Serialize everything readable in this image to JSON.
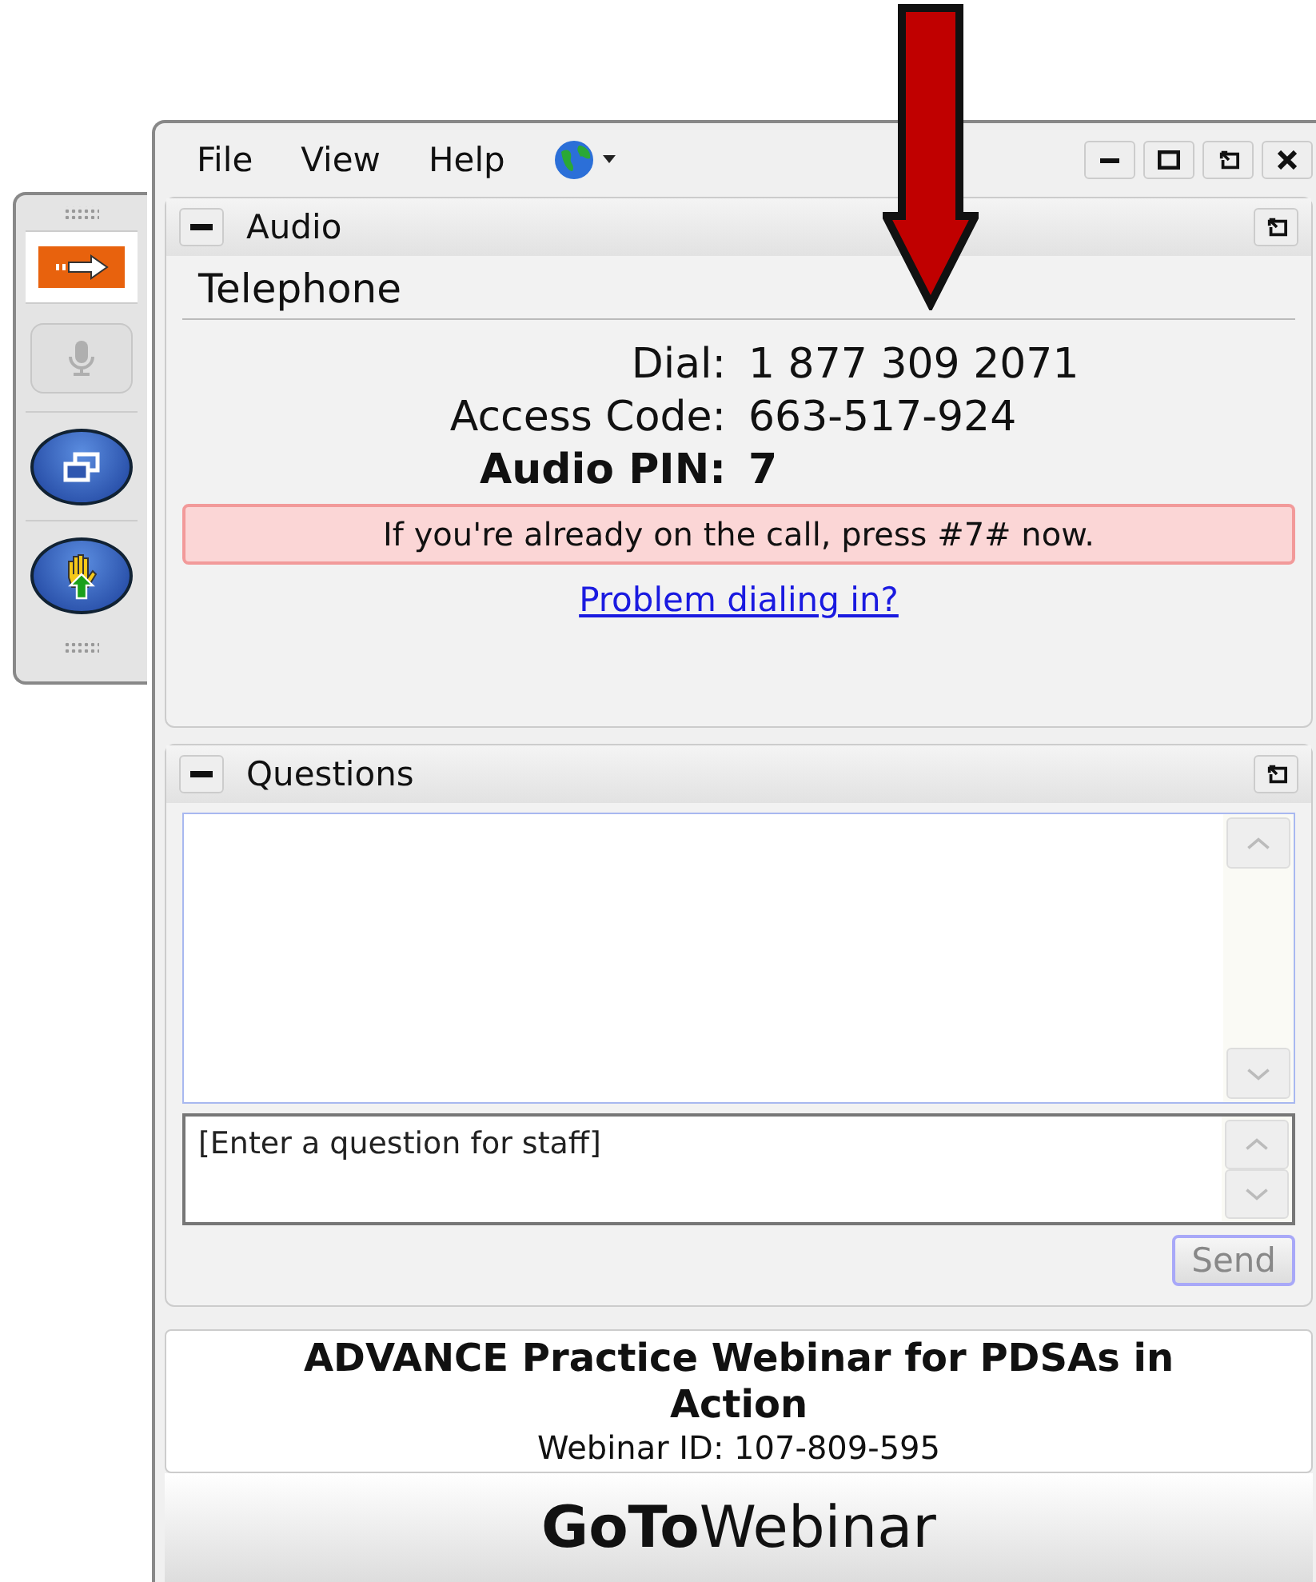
{
  "toolbar": [
    {
      "kind": "arrow",
      "disabled": false
    },
    {
      "kind": "mic",
      "disabled": true
    },
    {
      "kind": "windows",
      "disabled": false
    },
    {
      "kind": "hand",
      "disabled": false
    }
  ],
  "menu": [
    "File",
    "View",
    "Help"
  ],
  "audio": {
    "title": "Audio",
    "heading": "Telephone",
    "rows": [
      {
        "label": "Dial:",
        "value": "1 877 309 2071",
        "bold": false
      },
      {
        "label": "Access Code:",
        "value": "663-517-924",
        "bold": false
      },
      {
        "label": "Audio PIN:",
        "value": "7",
        "bold": true
      }
    ],
    "notice": "If you're already on the call, press #7# now.",
    "link": "Problem dialing in?"
  },
  "questions": {
    "title": "Questions",
    "placeholder": "[Enter a question for staff]",
    "send": "Send"
  },
  "footer": {
    "title": "ADVANCE Practice Webinar for PDSAs in Action",
    "webinar_id": "Webinar ID: 107-809-595",
    "logo": "**GoTo**Webinar"
  }
}
